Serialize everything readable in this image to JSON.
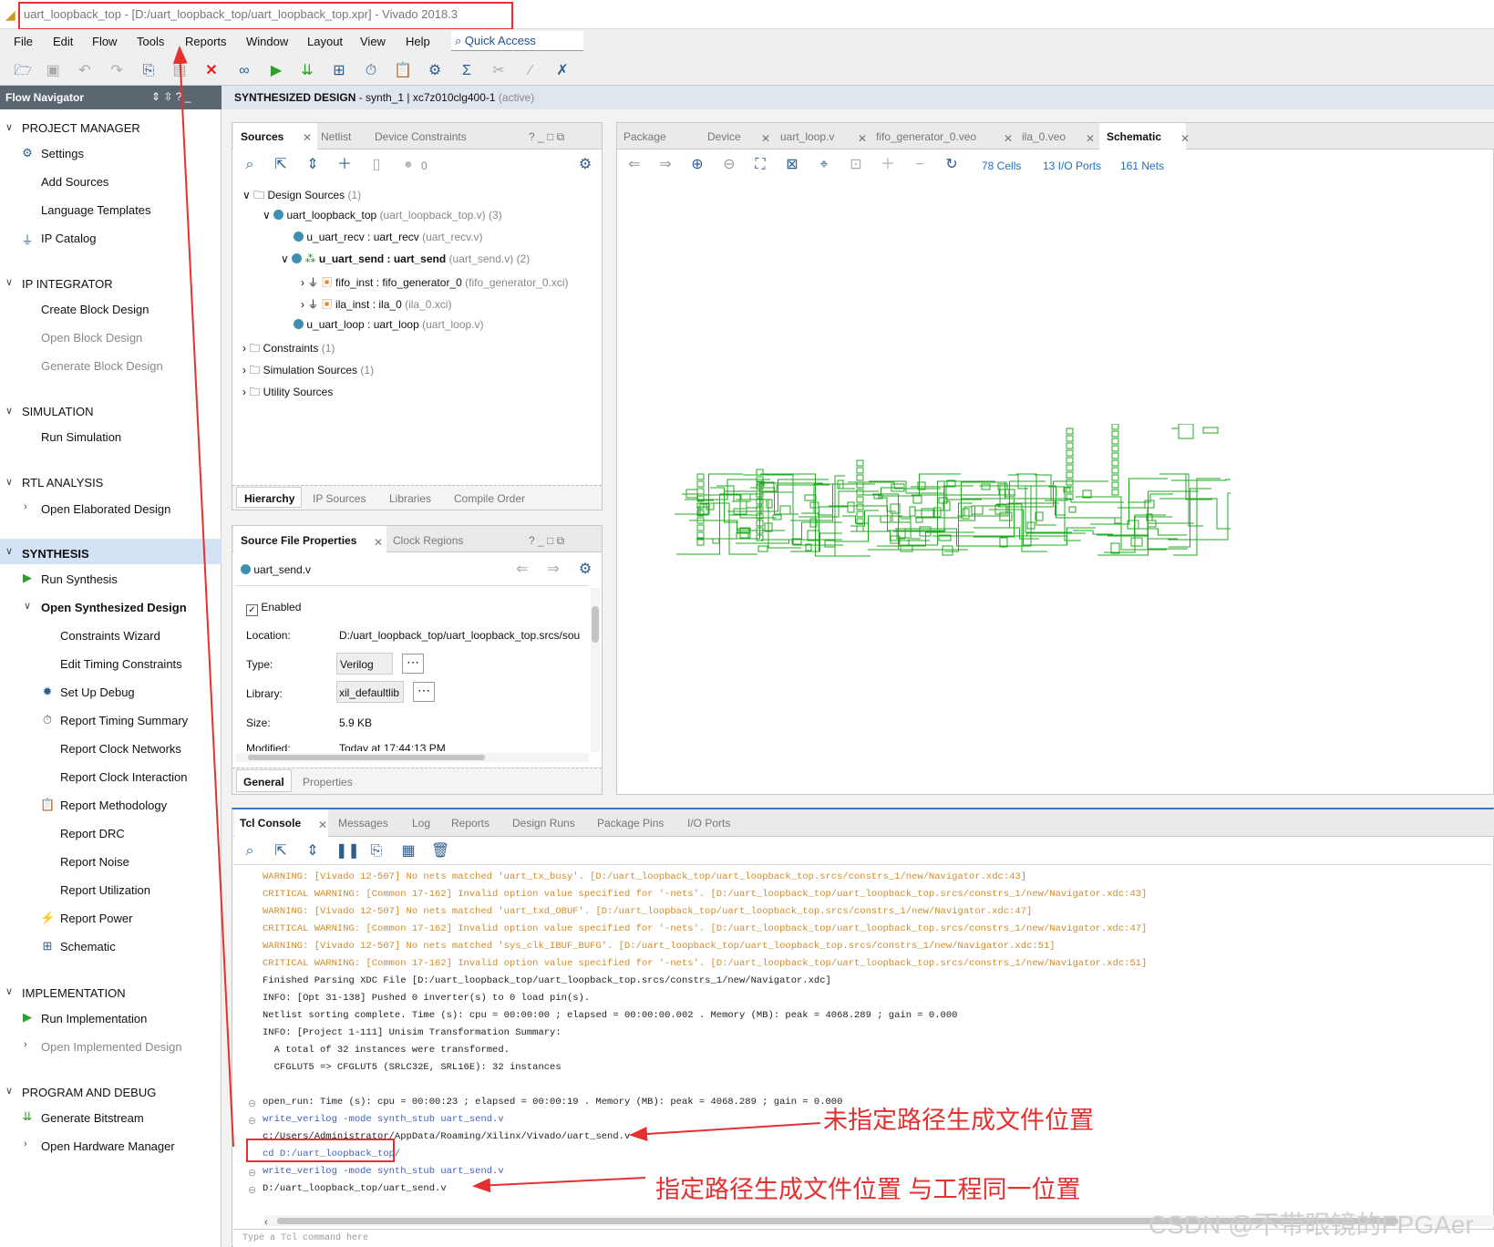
{
  "window": {
    "title": "uart_loopback_top - [D:/uart_loopback_top/uart_loopback_top.xpr] - Vivado 2018.3"
  },
  "menu": [
    "File",
    "Edit",
    "Flow",
    "Tools",
    "Reports",
    "Window",
    "Layout",
    "View",
    "Help"
  ],
  "quick_access": "Quick Access",
  "flow_navigator": {
    "title": "Flow Navigator",
    "project_manager": "PROJECT MANAGER",
    "settings": "Settings",
    "add_sources": "Add Sources",
    "language_templates": "Language Templates",
    "ip_catalog": "IP Catalog",
    "ip_integrator": "IP INTEGRATOR",
    "create_block_design": "Create Block Design",
    "open_block_design": "Open Block Design",
    "generate_block_design": "Generate Block Design",
    "simulation": "SIMULATION",
    "run_simulation": "Run Simulation",
    "rtl_analysis": "RTL ANALYSIS",
    "open_elaborated": "Open Elaborated Design",
    "synthesis": "SYNTHESIS",
    "run_synthesis": "Run Synthesis",
    "open_synth": "Open Synthesized Design",
    "constraints_wizard": "Constraints Wizard",
    "edit_timing": "Edit Timing Constraints",
    "setup_debug": "Set Up Debug",
    "report_timing": "Report Timing Summary",
    "report_clock_networks": "Report Clock Networks",
    "report_clock_interaction": "Report Clock Interaction",
    "report_methodology": "Report Methodology",
    "report_drc": "Report DRC",
    "report_noise": "Report Noise",
    "report_utilization": "Report Utilization",
    "report_power": "Report Power",
    "schematic": "Schematic",
    "implementation": "IMPLEMENTATION",
    "run_implementation": "Run Implementation",
    "open_implemented": "Open Implemented Design",
    "program_debug": "PROGRAM AND DEBUG",
    "generate_bitstream": "Generate Bitstream",
    "open_hw_manager": "Open Hardware Manager"
  },
  "design_header": {
    "title": "SYNTHESIZED DESIGN",
    "detail": " - synth_1 | xc7z010clg400-1",
    "status": "(active)"
  },
  "sources": {
    "tabs": [
      "Sources",
      "Netlist",
      "Device Constraints"
    ],
    "count": "0",
    "tree": {
      "design_sources": "Design Sources",
      "design_sources_n": "(1)",
      "top": "uart_loopback_top",
      "top_file": "(uart_loopback_top.v) (3)",
      "recv": "u_uart_recv : uart_recv",
      "recv_file": "(uart_recv.v)",
      "send": "u_uart_send : uart_send",
      "send_file": "(uart_send.v) (2)",
      "fifo": "fifo_inst : fifo_generator_0",
      "fifo_file": "(fifo_generator_0.xci)",
      "ila": "ila_inst : ila_0",
      "ila_file": "(ila_0.xci)",
      "loop": "u_uart_loop : uart_loop",
      "loop_file": "(uart_loop.v)",
      "constraints": "Constraints",
      "constraints_n": "(1)",
      "sim": "Simulation Sources",
      "sim_n": "(1)",
      "utility": "Utility Sources"
    },
    "bottom_tabs": [
      "Hierarchy",
      "IP Sources",
      "Libraries",
      "Compile Order"
    ]
  },
  "props": {
    "tabs": [
      "Source File Properties",
      "Clock Regions"
    ],
    "file": "uart_send.v",
    "enabled": "Enabled",
    "location_label": "Location:",
    "location": "D:/uart_loopback_top/uart_loopback_top.srcs/sou",
    "type_label": "Type:",
    "type": "Verilog",
    "library_label": "Library:",
    "library": "xil_defaultlib",
    "size_label": "Size:",
    "size": "5.9 KB",
    "modified_label": "Modified:",
    "modified": "Today at 17:44:13 PM",
    "bottom_tabs": [
      "General",
      "Properties"
    ]
  },
  "schematic_panel": {
    "tabs": [
      "Package",
      "Device",
      "uart_loop.v",
      "fifo_generator_0.veo",
      "ila_0.veo",
      "Schematic"
    ],
    "cells": "78 Cells",
    "ports": "13 I/O Ports",
    "nets": "161 Nets"
  },
  "console": {
    "tabs": [
      "Tcl Console",
      "Messages",
      "Log",
      "Reports",
      "Design Runs",
      "Package Pins",
      "I/O Ports"
    ],
    "lines": [
      "WARNING: [Vivado 12-507] No nets matched 'uart_tx_busy'. [D:/uart_loopback_top/uart_loopback_top.srcs/constrs_1/new/Navigator.xdc:43]",
      "CRITICAL WARNING: [Common 17-162] Invalid option value specified for '-nets'. [D:/uart_loopback_top/uart_loopback_top.srcs/constrs_1/new/Navigator.xdc:43]",
      "WARNING: [Vivado 12-507] No nets matched 'uart_txd_OBUF'. [D:/uart_loopback_top/uart_loopback_top.srcs/constrs_1/new/Navigator.xdc:47]",
      "CRITICAL WARNING: [Common 17-162] Invalid option value specified for '-nets'. [D:/uart_loopback_top/uart_loopback_top.srcs/constrs_1/new/Navigator.xdc:47]",
      "WARNING: [Vivado 12-507] No nets matched 'sys_clk_IBUF_BUFG'. [D:/uart_loopback_top/uart_loopback_top.srcs/constrs_1/new/Navigator.xdc:51]",
      "CRITICAL WARNING: [Common 17-162] Invalid option value specified for '-nets'. [D:/uart_loopback_top/uart_loopback_top.srcs/constrs_1/new/Navigator.xdc:51]",
      "Finished Parsing XDC File [D:/uart_loopback_top/uart_loopback_top.srcs/constrs_1/new/Navigator.xdc]",
      "INFO: [Opt 31-138] Pushed 0 inverter(s) to 0 load pin(s).",
      "Netlist sorting complete. Time (s): cpu = 00:00:00 ; elapsed = 00:00:00.002 . Memory (MB): peak = 4068.289 ; gain = 0.000",
      "INFO: [Project 1-111] Unisim Transformation Summary:",
      "  A total of 32 instances were transformed.",
      "  CFGLUT5 => CFGLUT5 (SRLC32E, SRL16E): 32 instances",
      "",
      "open_run: Time (s): cpu = 00:00:23 ; elapsed = 00:00:19 . Memory (MB): peak = 4068.289 ; gain = 0.000",
      "write_verilog -mode synth_stub uart_send.v",
      "c:/Users/Administrator/AppData/Roaming/Xilinx/Vivado/uart_send.v",
      "cd D:/uart_loopback_top/",
      "write_verilog -mode synth_stub uart_send.v",
      "D:/uart_loopback_top/uart_send.v"
    ],
    "input_placeholder": "Type a Tcl command here"
  },
  "annotations": {
    "a1": "未指定路径生成文件位置",
    "a2": "指定路径生成文件位置  与工程同一位置"
  },
  "watermark": "CSDN @不带眼镜的FPGAer",
  "colors": {
    "annotation": "#e53030",
    "warning": "#d08c2a",
    "command": "#4060c0",
    "schematic_net": "#22aa22"
  }
}
